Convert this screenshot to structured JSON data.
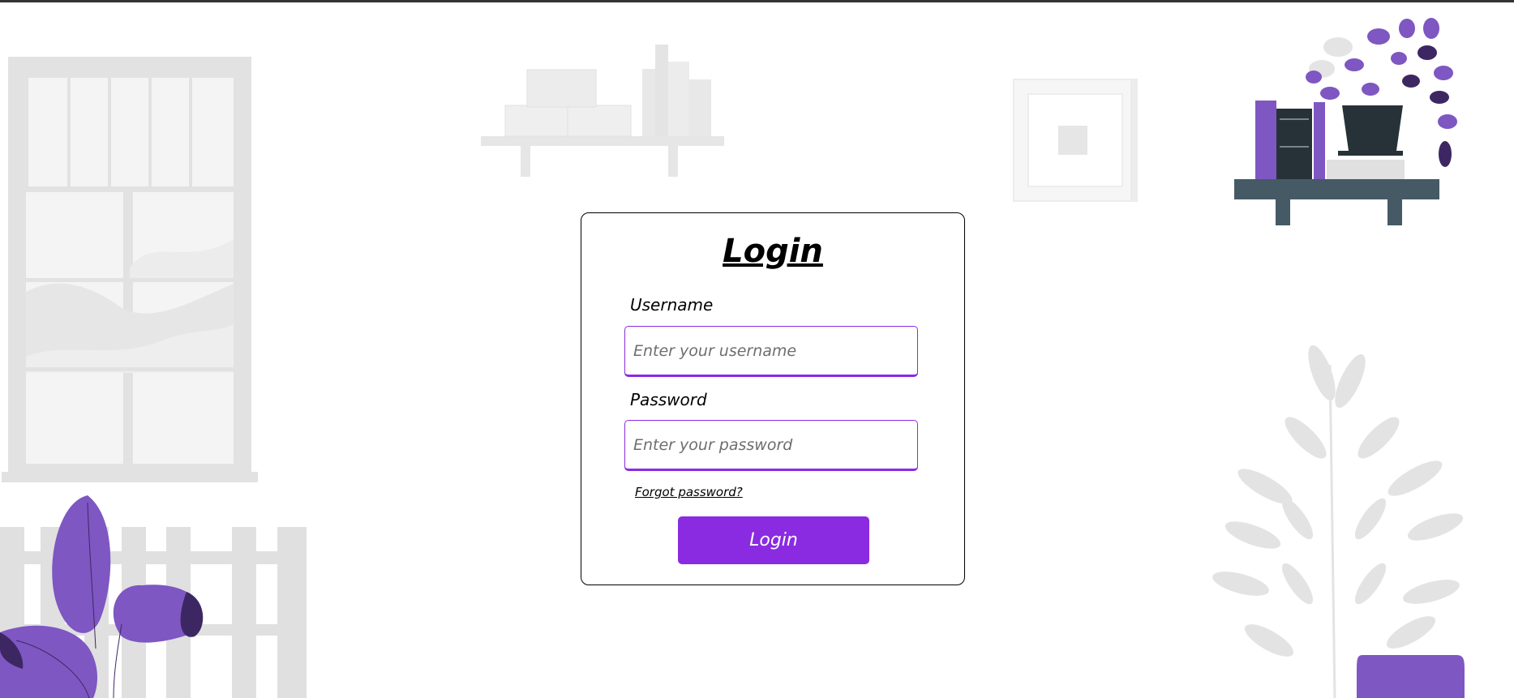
{
  "login": {
    "title": "Login",
    "username_label": "Username",
    "username_placeholder": "Enter your username",
    "password_label": "Password",
    "password_placeholder": "Enter your password",
    "forgot_link": "Forgot password?",
    "login_button": "Login"
  },
  "colors": {
    "accent": "#8a2be2",
    "illustration_purple": "#7e57c2",
    "illustration_dark_purple": "#3d2763",
    "illustration_gray": "#e0e0e0",
    "shelf_slate": "#455a64",
    "top_bar": "#333333"
  }
}
